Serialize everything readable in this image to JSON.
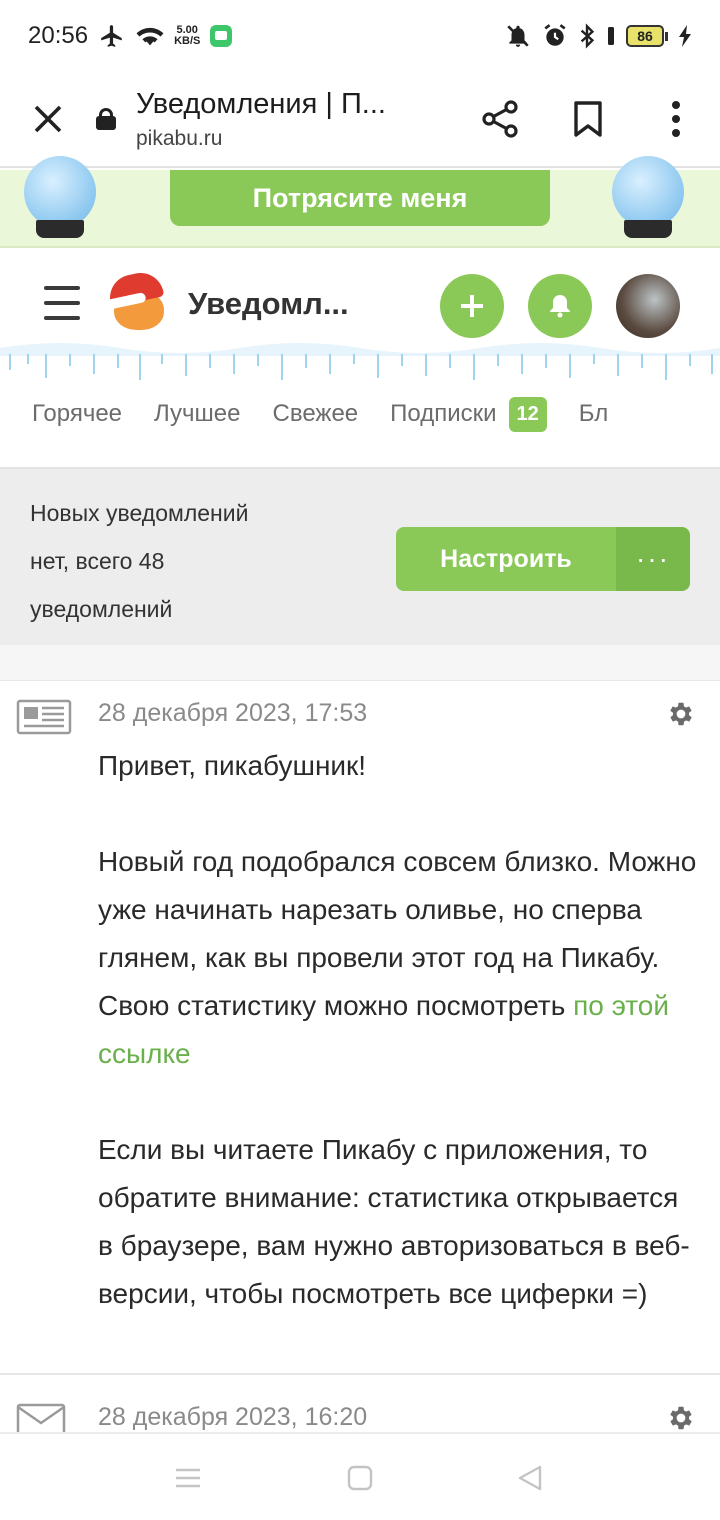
{
  "status_bar": {
    "time": "20:56",
    "net_speed_value": "5.00",
    "net_speed_unit": "KB/S",
    "battery_level": "86",
    "icons": [
      "airplane-icon",
      "wifi-icon",
      "message-app-icon",
      "mute-icon",
      "alarm-icon",
      "bluetooth-icon",
      "battery-icon",
      "charging-icon"
    ]
  },
  "browser": {
    "page_title": "Уведомления | П...",
    "host": "pikabu.ru",
    "icons": [
      "close-icon",
      "lock-icon",
      "share-icon",
      "bookmark-icon",
      "more-vertical-icon"
    ]
  },
  "promo": {
    "button_label": "Потрясите меня"
  },
  "header": {
    "title": "Уведомл...",
    "icons": [
      "menu-icon",
      "pikabu-logo",
      "add-icon",
      "bell-icon",
      "avatar"
    ]
  },
  "nav": {
    "tabs": [
      {
        "label": "Горячее"
      },
      {
        "label": "Лучшее"
      },
      {
        "label": "Свежее"
      },
      {
        "label": "Подписки",
        "badge": "12"
      },
      {
        "label": "Бл"
      }
    ]
  },
  "notifications_panel": {
    "line1": "Новых уведомлений",
    "line2": "нет, всего 48",
    "line3": "уведомлений",
    "configure_label": "Настроить",
    "more_label": "···"
  },
  "items": [
    {
      "type_icon": "news-icon",
      "date": "28 декабря 2023, 17:53",
      "greeting": "Привет, пикабушник!",
      "paragraph1": "Новый год подобрался совсем близко. Можно уже начинать нарезать оливье, но сперва глянем, как вы провели этот год на Пикабу. Свою статистику можно посмотреть ",
      "link_text": "по этой ссылке",
      "paragraph2": "Если вы читаете Пикабу с приложения, то обратите внимание: статистика открывается в браузере, вам нужно авторизоваться в веб-версии, чтобы посмотреть все циферки =)"
    },
    {
      "type_icon": "mail-icon",
      "date": "28 декабря 2023, 16:20"
    }
  ],
  "colors": {
    "accent_green": "#8ac858",
    "link_green": "#6ab04c",
    "panel_gray": "#ededed",
    "promo_bg": "#eaf7d8"
  }
}
